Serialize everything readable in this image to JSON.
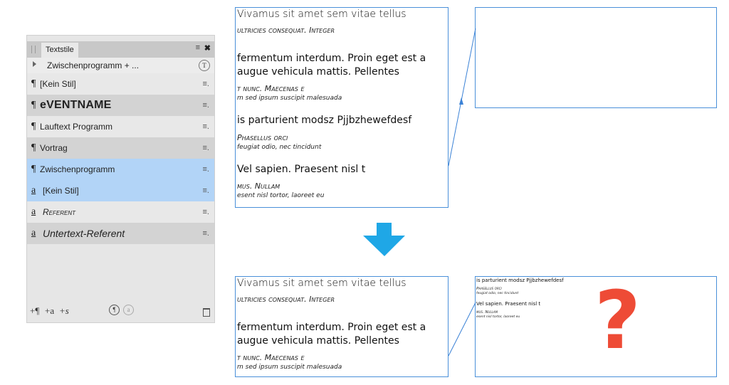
{
  "panel": {
    "tab_label": "Textstile",
    "menu_icon": "≡",
    "close_icon": "✖",
    "group_label": "Zwischenprogramm + ...",
    "clear_icon_glyph": "T",
    "rows": [
      {
        "mark": "¶",
        "label": "[Kein Stil]"
      },
      {
        "mark": "¶",
        "label": "eVENTNAME"
      },
      {
        "mark": "¶",
        "label": "Lauftext Programm"
      },
      {
        "mark": "¶",
        "label": "Vortrag"
      },
      {
        "mark": "¶",
        "label": "Zwischenprogramm"
      },
      {
        "mark": "a",
        "label": "[Kein Stil]"
      },
      {
        "mark": "a",
        "label": "Referent"
      },
      {
        "mark": "a",
        "label": "Untertext-Referent"
      }
    ],
    "row_menu": "≡.",
    "bottom": {
      "new_para": "+¶",
      "new_char": "+a",
      "new_style": "+s",
      "para_circle": "¶",
      "char_circle": "a"
    }
  },
  "frame_top_left": {
    "lines": [
      "Vivamus sit amet sem vitae tellus",
      "ultricies consequat. Integer",
      "fermentum interdum. Proin eget est a",
      "augue vehicula mattis. Pellentes",
      "t nunc. Maecenas e",
      "m sed ipsum suscipit malesuada",
      "is parturient modsz Pjjbzhewefdesf",
      "Phasellus orci",
      "feugiat odio, nec tincidunt",
      "Vel sapien. Praesent nisl t",
      " mus. Nullam",
      "esent nisl tortor, laoreet eu"
    ]
  },
  "frame_bottom_left": {
    "lines": [
      "Vivamus sit amet sem vitae tellus",
      "ultricies consequat. Integer",
      "fermentum interdum. Proin eget est a",
      "augue vehicula mattis. Pellentes",
      "t nunc. Maecenas e",
      "m sed ipsum suscipit malesuada"
    ]
  },
  "frame_bottom_right": {
    "lines": [
      "is parturient modsz Pjjbzhewefdesf",
      "Phasellus orci",
      "feugiat odio, nec tincidunt",
      "Vel sapien. Praesent nisl t",
      " mus. Nullam",
      "esent nisl tortor, laoreet eu"
    ]
  },
  "question_mark": "?",
  "colors": {
    "frame_border": "#4a90d9",
    "arrow": "#1fa7e6",
    "question": "#ee4b36",
    "selected_row": "#b2d4f7"
  }
}
